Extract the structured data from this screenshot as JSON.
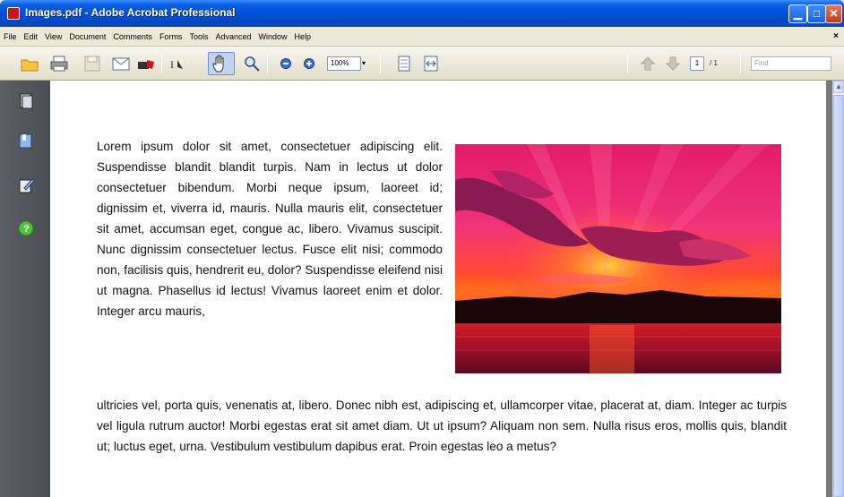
{
  "window": {
    "title": "Images.pdf - Adobe Acrobat Professional",
    "controls": {
      "minimize": "▁",
      "maximize": "□",
      "close": "✕"
    }
  },
  "menu": {
    "items": [
      "File",
      "Edit",
      "View",
      "Document",
      "Comments",
      "Forms",
      "Tools",
      "Advanced",
      "Window",
      "Help"
    ],
    "close_glyph": "×"
  },
  "toolbar": {
    "zoom_value": "100%",
    "zoom_arrow": "▾",
    "page_current": "1",
    "page_total": "/ 1",
    "find_placeholder": "Find",
    "icons": [
      "open-icon",
      "print-icon",
      "save-icon",
      "email-icon",
      "create-pdf-icon",
      "select-text-icon",
      "hand-tool-icon",
      "zoom-tool-icon",
      "zoom-out-icon",
      "zoom-in-icon",
      "fit-page-icon",
      "fit-width-icon",
      "previous-page-icon",
      "next-page-icon"
    ]
  },
  "nav_pane": {
    "icons": [
      "pages-icon",
      "bookmarks-icon",
      "signatures-icon",
      "help-icon"
    ]
  },
  "document": {
    "column_text": "Lorem ipsum dolor sit amet, consectetuer adipiscing elit. Suspendisse blandit blandit turpis. Nam in lectus ut dolor consectetuer bibendum. Morbi neque ipsum, laoreet id; dignissim et, viverra id, mauris. Nulla mauris elit, consectetuer sit amet, accumsan eget, congue ac, libero. Vivamus suscipit. Nunc dignissim consectetuer lectus. Fusce elit nisi; commodo non, facilisis quis, hendrerit eu, dolor? Suspendisse eleifend nisi ut magna. Phasellus id lectus! Vivamus laoreet enim et dolor. Integer arcu mauris,",
    "full_text": "ultricies vel, porta quis, venenatis at, libero. Donec nibh est, adipiscing et, ullamcorper vitae, placerat at, diam. Integer ac turpis vel ligula rutrum auctor! Morbi egestas erat sit amet diam. Ut ut ipsum? Aliquam non sem. Nulla risus eros, mollis quis, blandit ut; luctus eget, urna. Vestibulum vestibulum dapibus erat. Proin egestas leo a metus?",
    "image": "sunset-photo"
  },
  "scrollbar": {
    "up_arrow": "▲"
  }
}
